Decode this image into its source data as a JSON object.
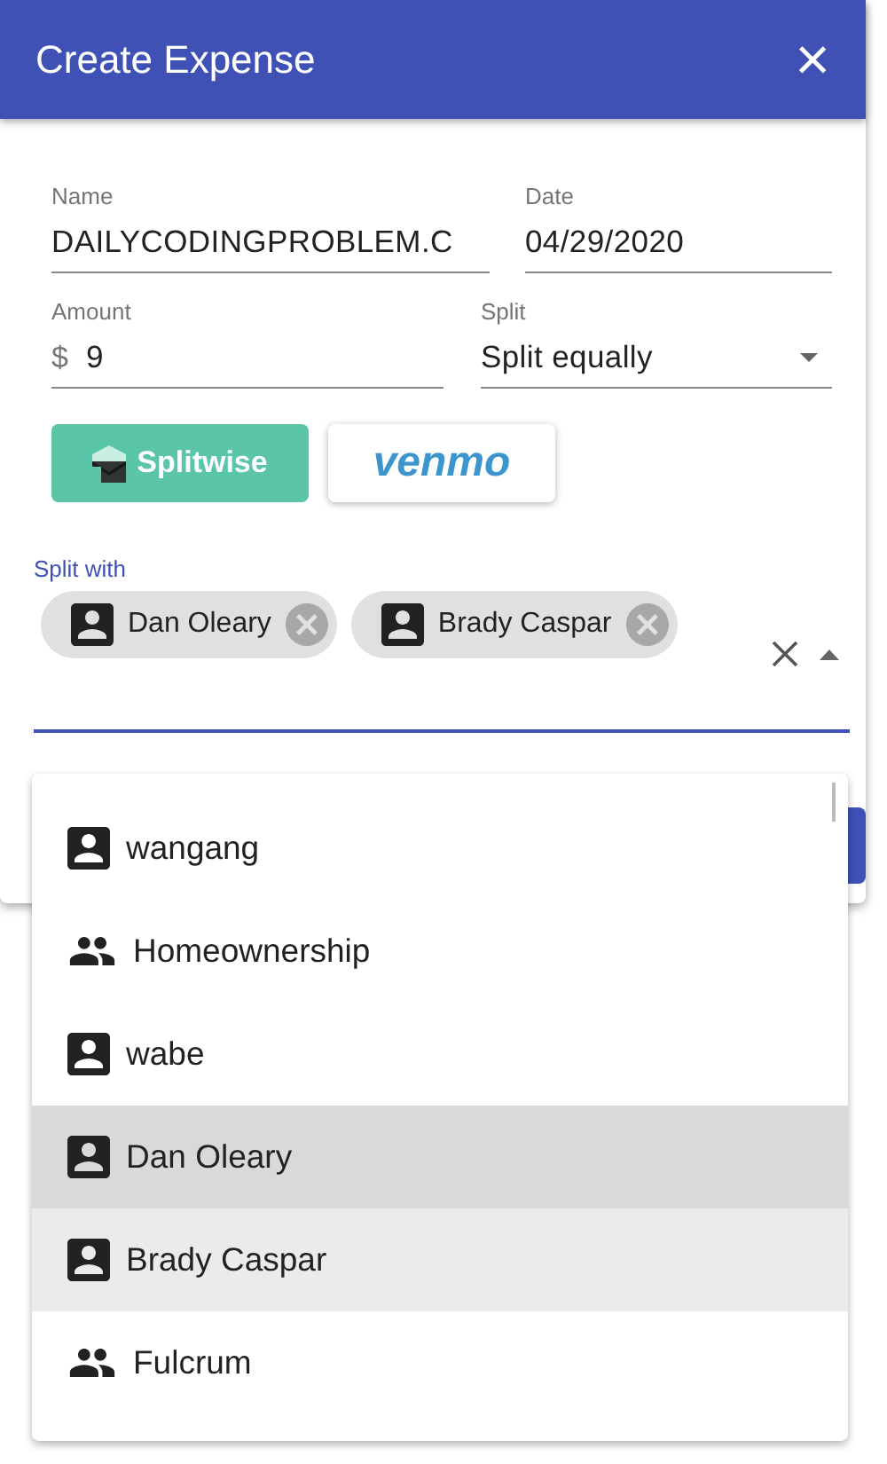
{
  "header": {
    "title": "Create Expense",
    "close": "×"
  },
  "fields": [
    {
      "kind": "text",
      "label": "Name",
      "value": "DAILYCODINGPROBLEM.C"
    },
    {
      "kind": "text",
      "label": "Date",
      "value": "04/29/2020"
    },
    {
      "kind": "money",
      "label": "Amount",
      "prefix": "$",
      "value": "9"
    },
    {
      "kind": "select",
      "label": "Split",
      "value": "Split equally"
    }
  ],
  "pay_buttons": [
    {
      "kind": "splitwise",
      "label": "Splitwise"
    },
    {
      "kind": "venmo",
      "label": "venmo"
    }
  ],
  "split_with": {
    "label": "Split with",
    "expanded": true,
    "chips": [
      {
        "kind": "person",
        "name": "Dan Oleary"
      },
      {
        "kind": "person",
        "name": "Brady Caspar"
      }
    ],
    "options": [
      {
        "kind": "person",
        "label": "wangang",
        "selected": false,
        "focused": false
      },
      {
        "kind": "group",
        "label": "Homeownership",
        "selected": false,
        "focused": false
      },
      {
        "kind": "person",
        "label": "wabe",
        "selected": false,
        "focused": false
      },
      {
        "kind": "person",
        "label": "Dan Oleary",
        "selected": true,
        "focused": true
      },
      {
        "kind": "person",
        "label": "Brady Caspar",
        "selected": true,
        "focused": false
      },
      {
        "kind": "group",
        "label": "Fulcrum",
        "selected": false,
        "focused": false
      }
    ]
  }
}
